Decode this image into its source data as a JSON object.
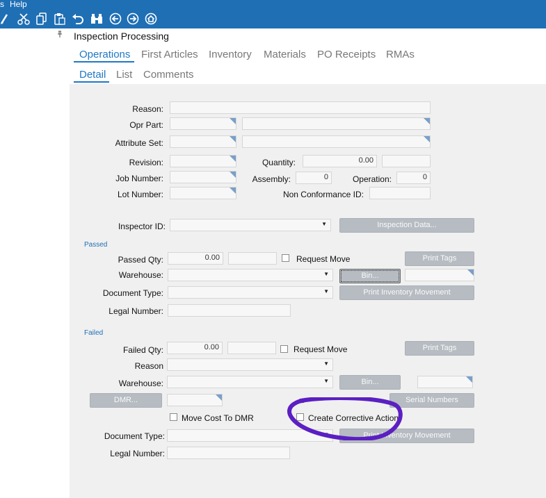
{
  "menu": {
    "items": [
      "s",
      "Help"
    ]
  },
  "toolbar": {
    "icons": [
      "brush-icon",
      "cut-icon",
      "copy-icon",
      "paste-icon",
      "undo-icon",
      "binoculars-icon",
      "back-icon",
      "forward-icon",
      "home-icon"
    ]
  },
  "page": {
    "title": "Inspection Processing"
  },
  "tabs": {
    "main": [
      "Operations",
      "First Articles",
      "Inventory",
      "Materials",
      "PO Receipts",
      "RMAs"
    ],
    "sub": [
      "Detail",
      "List",
      "Comments"
    ]
  },
  "form": {
    "reason_label": "Reason:",
    "opr_part_label": "Opr Part:",
    "attribute_set_label": "Attribute Set:",
    "revision_label": "Revision:",
    "quantity_label": "Quantity:",
    "quantity_value": "0.00",
    "job_number_label": "Job Number:",
    "assembly_label": "Assembly:",
    "assembly_value": "0",
    "operation_label": "Operation:",
    "operation_value": "0",
    "lot_number_label": "Lot Number:",
    "non_conformance_label": "Non Conformance ID:",
    "inspector_id_label": "Inspector ID:",
    "inspection_data_button": "Inspection Data..."
  },
  "passed": {
    "section_label": "Passed",
    "qty_label": "Passed Qty:",
    "qty_value": "0.00",
    "request_move_label": "Request Move",
    "print_tags_button": "Print Tags",
    "warehouse_label": "Warehouse:",
    "bin_button": "Bin...",
    "document_type_label": "Document Type:",
    "print_inventory_button": "Print Inventory Movement",
    "legal_number_label": "Legal Number:"
  },
  "failed": {
    "section_label": "Failed",
    "qty_label": "Failed Qty:",
    "qty_value": "0.00",
    "request_move_label": "Request Move",
    "print_tags_button": "Print Tags",
    "reason_label": "Reason",
    "warehouse_label": "Warehouse:",
    "bin_button": "Bin...",
    "dmr_button": "DMR...",
    "serial_numbers_button": "Serial Numbers",
    "move_cost_label": "Move Cost To DMR",
    "corrective_action_label": "Create Corrective Action",
    "document_type_label": "Document Type:",
    "print_inventory_button": "Print Inventory Movement",
    "legal_number_label": "Legal Number:"
  },
  "colors": {
    "header_blue": "#1f6fb5",
    "tab_active": "#1f77c4",
    "annotation_purple": "#5b1fc2"
  }
}
